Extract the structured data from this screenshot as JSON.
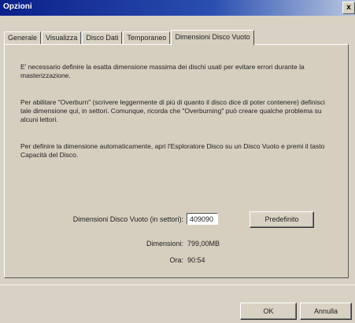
{
  "window": {
    "title": "Opzioni",
    "close_glyph": "x"
  },
  "tabs": [
    {
      "label": "Generale"
    },
    {
      "label": "Visualizza"
    },
    {
      "label": "Disco Dati"
    },
    {
      "label": "Temporaneo"
    },
    {
      "label": "Dimensioni Disco Vuoto"
    }
  ],
  "content": {
    "para1": "E' necessario definire la esatta dimensione massima dei dischi usati per evitare errori durante la masterizzazione.",
    "para2": "Per abilitare \"Overburn\" (scrivere leggermente di più di quanto il disco dice di poter contenere) definisci tale dimensione qui, in settori. Comunque, ricorda che \"Overburning\" può creare qualche problema su alcuni lettori.",
    "para3": "Per definire la dimensione automaticamente, apri l'Esploratore Disco su un Disco Vuoto e premi il tasto Capacità del Disco."
  },
  "form": {
    "size_label": "Dimensioni Disco Vuoto (in settori):",
    "size_value": "409090",
    "default_button": "Predefinito",
    "dimension_label": "Dimensioni:",
    "dimension_value": "799,00MB",
    "time_label": "Ora:",
    "time_value": "90:54"
  },
  "buttons": {
    "ok": "OK",
    "cancel": "Annulla"
  }
}
